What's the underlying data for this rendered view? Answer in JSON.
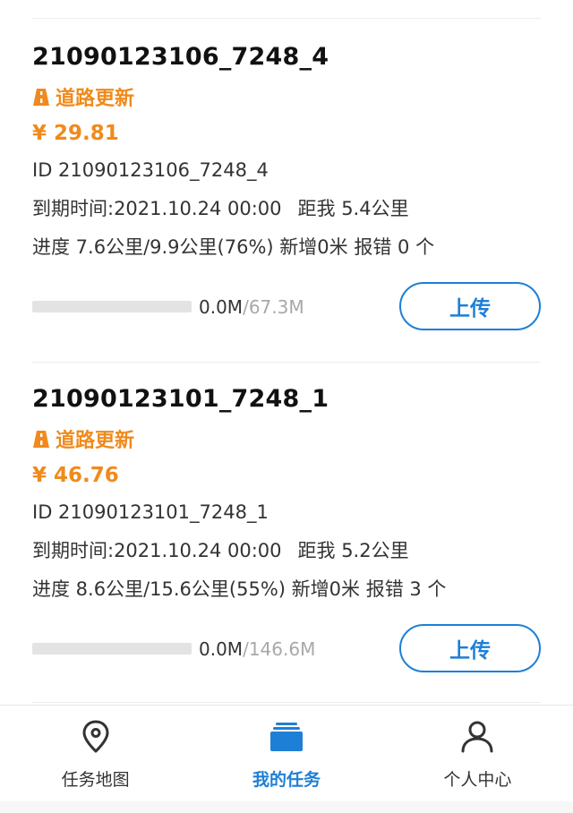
{
  "tasks": [
    {
      "title": "21090123106_7248_4",
      "type_label": "道路更新",
      "price": "¥ 29.81",
      "id_line": "ID 21090123106_7248_4",
      "due_line": "到期时间:2021.10.24 00:00",
      "distance_line": "距我 5.4公里",
      "progress_line": "进度 7.6公里/9.9公里(76%)",
      "added_line": "新增0米",
      "error_line": "报错 0 个",
      "uploaded_size": "0.0M",
      "total_size": "67.3M",
      "upload_progress": 0,
      "upload_label": "上传"
    },
    {
      "title": "21090123101_7248_1",
      "type_label": "道路更新",
      "price": "¥ 46.76",
      "id_line": "ID 21090123101_7248_1",
      "due_line": "到期时间:2021.10.24 00:00",
      "distance_line": "距我 5.2公里",
      "progress_line": "进度 8.6公里/15.6公里(55%)",
      "added_line": "新增0米",
      "error_line": "报错 3 个",
      "uploaded_size": "0.0M",
      "total_size": "146.6M",
      "upload_progress": 0,
      "upload_label": "上传"
    }
  ],
  "size_separator": "/",
  "tabbar": {
    "items": [
      {
        "label": "任务地图",
        "icon": "map-pin-icon",
        "active": false
      },
      {
        "label": "我的任务",
        "icon": "task-stack-icon",
        "active": true
      },
      {
        "label": "个人中心",
        "icon": "person-icon",
        "active": false
      }
    ]
  },
  "colors": {
    "accent": "#1e7fd6",
    "orange": "#f08a1c",
    "progress_track": "#e3e3e3"
  }
}
